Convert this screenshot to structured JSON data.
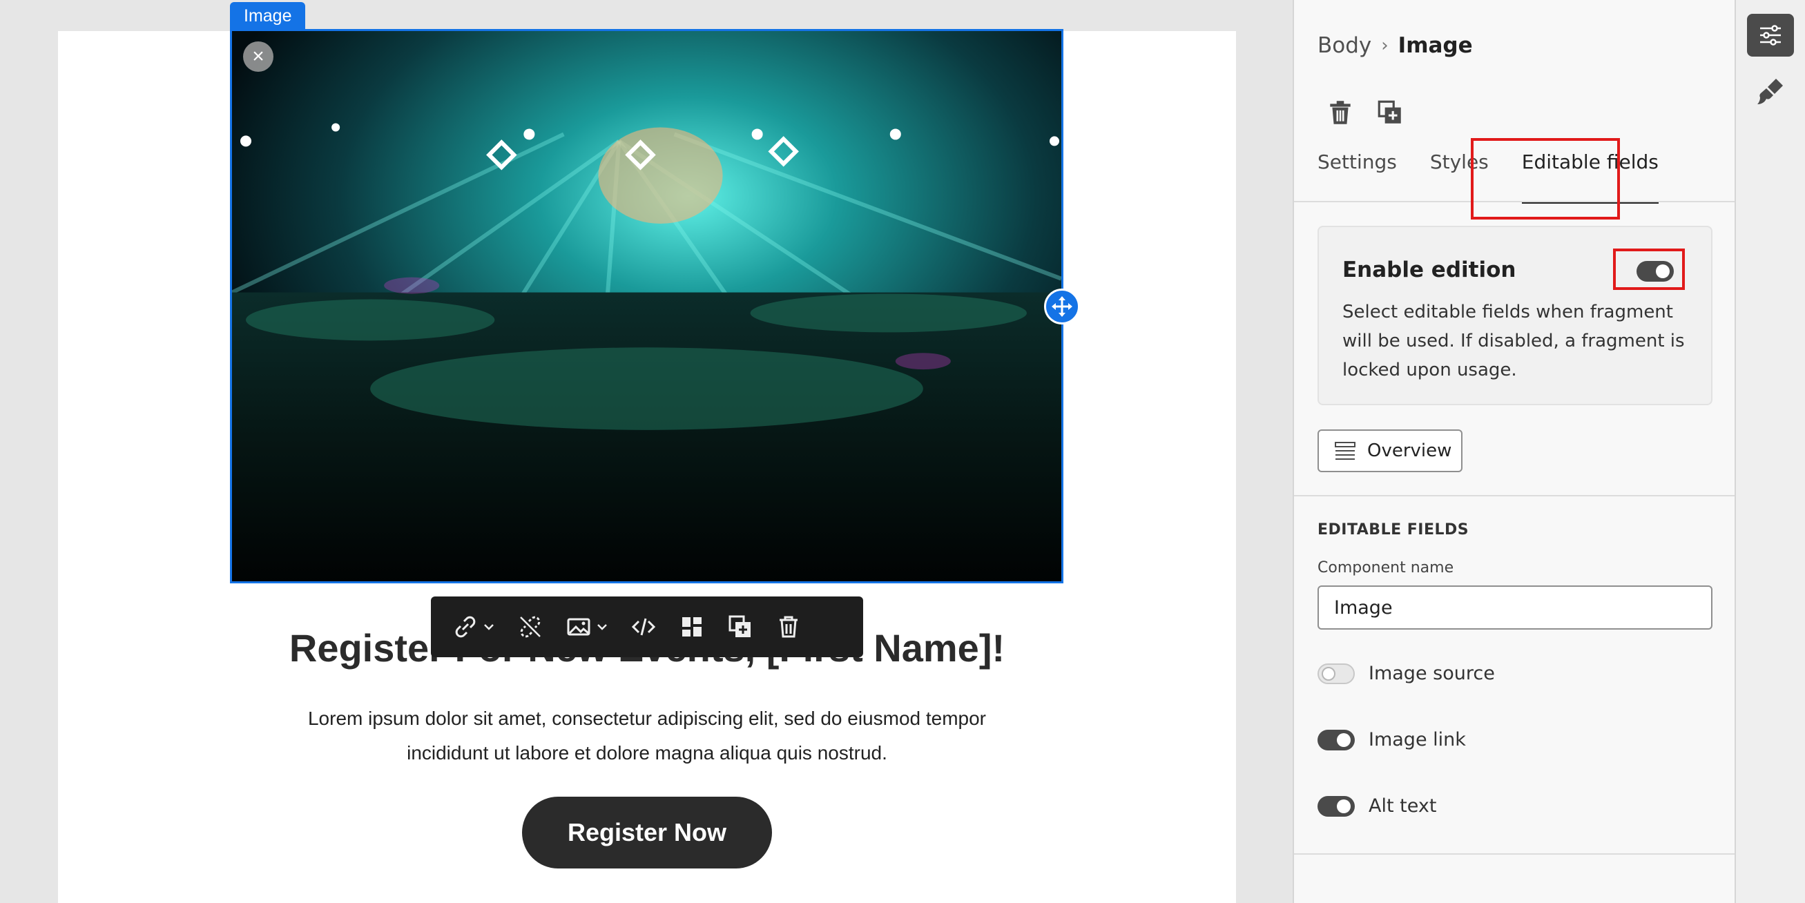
{
  "canvas": {
    "image_tag": "Image",
    "headline": "Register For New Events, [First Name]!",
    "body_text": "Lorem ipsum dolor sit amet, consectetur adipiscing elit, sed do eiusmod tempor incididunt ut labore et dolore magna aliqua quis nostrud.",
    "cta_label": "Register Now",
    "toolbar": [
      "link-icon",
      "unlink-icon",
      "image-icon",
      "code-icon",
      "layout-icon",
      "duplicate-icon",
      "delete-icon"
    ]
  },
  "panel": {
    "breadcrumb": {
      "root": "Body",
      "separator": "›",
      "current": "Image"
    },
    "tabs": [
      "Settings",
      "Styles",
      "Editable fields"
    ],
    "active_tab": "Editable fields",
    "enable": {
      "title": "Enable edition",
      "description": "Select editable fields when fragment will be used. If disabled, a fragment is locked upon usage.",
      "enabled": true
    },
    "overview_label": "Overview",
    "editable_fields": {
      "heading": "EDITABLE FIELDS",
      "component_name_label": "Component name",
      "component_name_value": "Image",
      "fields": [
        {
          "label": "Image source",
          "enabled": false
        },
        {
          "label": "Image link",
          "enabled": true
        },
        {
          "label": "Alt text",
          "enabled": true
        }
      ]
    }
  },
  "colors": {
    "accent": "#1473e6",
    "highlight": "#e11a1a",
    "button_dark": "#2b2b2b"
  }
}
